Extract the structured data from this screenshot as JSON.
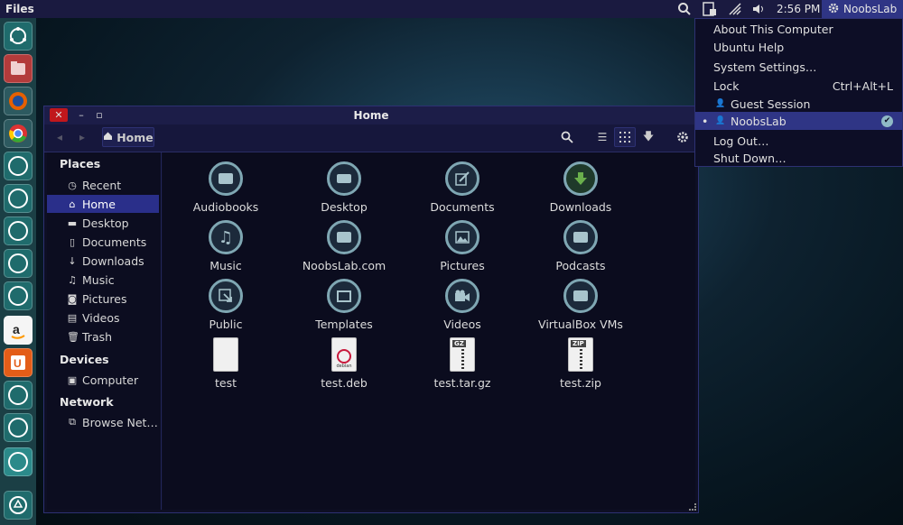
{
  "panel": {
    "app_title": "Files",
    "time": "2:56 PM",
    "user": "NoobsLab"
  },
  "launcher": {
    "items": [
      "dash-home",
      "files",
      "firefox",
      "chrome",
      "app-5",
      "app-6",
      "app-7",
      "app-8",
      "app-9",
      "amazon",
      "ubuntu-one",
      "app-12",
      "app-13",
      "app-14",
      "trash"
    ]
  },
  "window": {
    "title": "Home",
    "location": "Home"
  },
  "sidebar": {
    "places_header": "Places",
    "places": [
      {
        "label": "Recent",
        "icon": "clock-icon"
      },
      {
        "label": "Home",
        "icon": "home-icon"
      },
      {
        "label": "Desktop",
        "icon": "folder-icon"
      },
      {
        "label": "Documents",
        "icon": "document-icon"
      },
      {
        "label": "Downloads",
        "icon": "download-icon"
      },
      {
        "label": "Music",
        "icon": "music-icon"
      },
      {
        "label": "Pictures",
        "icon": "camera-icon"
      },
      {
        "label": "Videos",
        "icon": "film-icon"
      },
      {
        "label": "Trash",
        "icon": "trash-icon"
      }
    ],
    "devices_header": "Devices",
    "devices": [
      {
        "label": "Computer",
        "icon": "drive-icon"
      }
    ],
    "network_header": "Network",
    "network": [
      {
        "label": "Browse Net…",
        "icon": "network-icon"
      }
    ]
  },
  "files": [
    {
      "name": "Audiobooks",
      "type": "folder"
    },
    {
      "name": "Desktop",
      "type": "folder"
    },
    {
      "name": "Documents",
      "type": "folder"
    },
    {
      "name": "Downloads",
      "type": "folder"
    },
    {
      "name": "Music",
      "type": "folder"
    },
    {
      "name": "NoobsLab.com",
      "type": "folder"
    },
    {
      "name": "Pictures",
      "type": "folder"
    },
    {
      "name": "Podcasts",
      "type": "folder"
    },
    {
      "name": "Public",
      "type": "folder"
    },
    {
      "name": "Templates",
      "type": "folder"
    },
    {
      "name": "Videos",
      "type": "folder"
    },
    {
      "name": "VirtualBox VMs",
      "type": "folder"
    },
    {
      "name": "test",
      "type": "file"
    },
    {
      "name": "test.deb",
      "type": "deb"
    },
    {
      "name": "test.tar.gz",
      "type": "gz"
    },
    {
      "name": "test.zip",
      "type": "zip"
    }
  ],
  "file_tags": {
    "gz": "GZ",
    "zip": "ZIP",
    "deb": "debian"
  },
  "user_menu": {
    "items": [
      {
        "label": "About This Computer"
      },
      {
        "label": "Ubuntu Help"
      },
      {
        "label": "System Settings…"
      },
      {
        "label": "Lock",
        "accel": "Ctrl+Alt+L"
      },
      {
        "label": "Guest Session"
      },
      {
        "label": "NoobsLab"
      },
      {
        "label": "Log Out…"
      },
      {
        "label": "Shut Down…"
      }
    ]
  },
  "colors": {
    "panel": "#1a1a40",
    "selection": "#2a2f8a",
    "folder_icon": "#7fa7b3"
  }
}
